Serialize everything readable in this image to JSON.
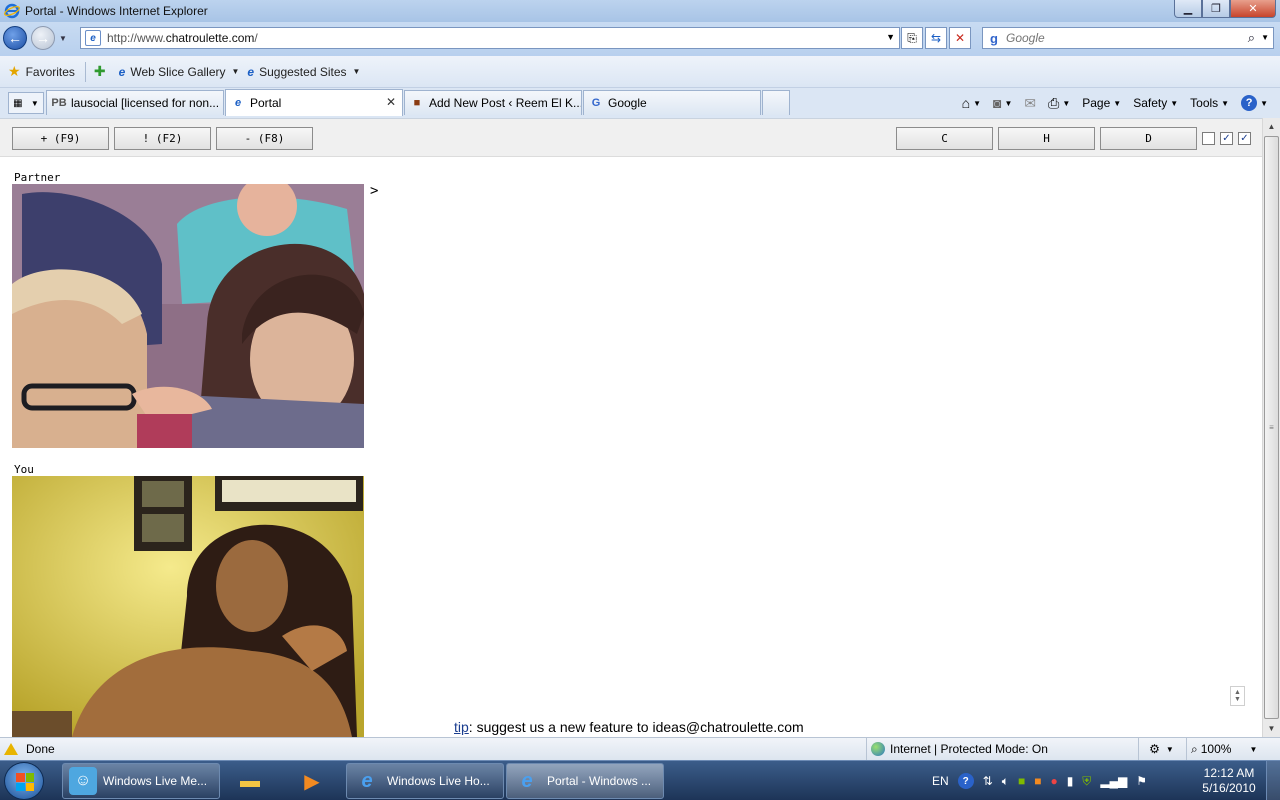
{
  "window": {
    "title": "Portal - Windows Internet Explorer",
    "minimize": "▁",
    "maximize": "❐",
    "close": "✕"
  },
  "address": {
    "url_prefix": "http://www.",
    "url_domain": "chatroulette.com",
    "url_suffix": "/",
    "search_placeholder": "Google"
  },
  "favorites": {
    "favorites_label": "Favorites",
    "web_slice_gallery": "Web Slice Gallery",
    "suggested_sites": "Suggested Sites"
  },
  "tabs": [
    {
      "label": "lausocial [licensed for non...",
      "icon": "PB"
    },
    {
      "label": "Portal",
      "icon": "e"
    },
    {
      "label": "Add New Post ‹ Reem El K...",
      "icon": "■"
    },
    {
      "label": "Google",
      "icon": "G"
    },
    {
      "label": "",
      "icon": ""
    }
  ],
  "command_bar": {
    "page": "Page",
    "safety": "Safety",
    "tools": "Tools"
  },
  "chatroulette": {
    "buttons": {
      "add": "+ (F9)",
      "report": "! (F2)",
      "next": "- (F8)",
      "c": "C",
      "h": "H",
      "d": "D"
    },
    "checkboxes": [
      false,
      true,
      true
    ],
    "partner_label": "Partner",
    "you_label": "You",
    "prompt": ">",
    "tip_link": "tip",
    "tip_text": ": suggest us a new feature to ideas@chatroulette.com"
  },
  "status": {
    "text": "Done",
    "zone": "Internet | Protected Mode: On",
    "zoom": "100%"
  },
  "taskbar": {
    "items": [
      {
        "label": "Windows Live Me..."
      },
      {
        "label": "Windows Live Ho..."
      },
      {
        "label": "Portal - Windows ..."
      }
    ],
    "language": "EN",
    "time": "12:12 AM",
    "date": "5/16/2010"
  },
  "colors": {
    "accent": "#1c4fa5",
    "taskbar": "#1d3457"
  }
}
